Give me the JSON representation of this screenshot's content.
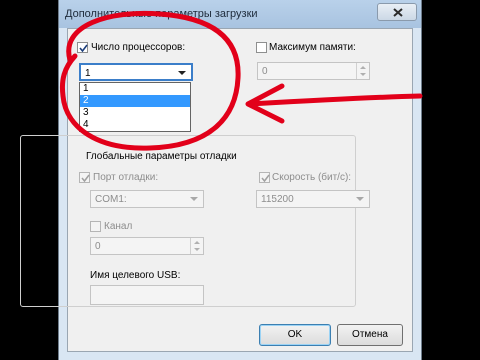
{
  "dialog": {
    "title": "Дополнительные параметры загрузки",
    "close_label": "×"
  },
  "processors": {
    "checkbox_label": "Число процессоров:",
    "checked": true,
    "selected_value": "1",
    "options": [
      "1",
      "2",
      "3",
      "4"
    ],
    "highlighted_option": "2"
  },
  "memory": {
    "checkbox_label": "Максимум памяти:",
    "checked": false,
    "value": "0"
  },
  "debug": {
    "group_title": "Глобальные параметры отладки",
    "port_label": "Порт отладки:",
    "port_value": "COM1:",
    "speed_label": "Скорость (бит/с):",
    "speed_value": "115200",
    "channel_label": "Канал",
    "channel_value": "0",
    "usb_label": "Имя целевого USB:",
    "usb_value": ""
  },
  "buttons": {
    "ok_label": "OK",
    "cancel_label": "Отмена"
  },
  "annotation": {
    "color": "#e2001a"
  }
}
